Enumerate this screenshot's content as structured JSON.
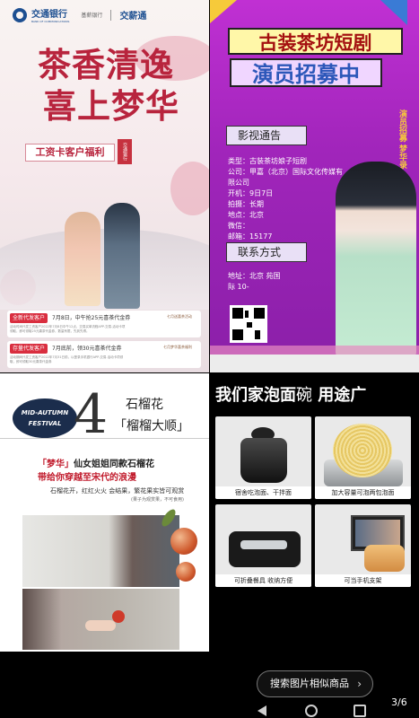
{
  "panel1": {
    "bank_name": "交通银行",
    "bank_en": "BANK OF COMMUNICATIONS",
    "sub_brand": "基薪银行",
    "salary_brand": "交薪通",
    "title_line1": "茶香清逸",
    "title_line2": "喜上梦华",
    "tag": "工资卡客户福利",
    "seal": "交通银行",
    "card1": {
      "label": "全新代发客户",
      "main": "7月8日，中午抢25元喜茶代金券",
      "desc": "活动时间代发工资客户2022年7月8日中午12点，交易买单流程APP-交易-活动卡项领取，即可领取25元喜茶代金券，数量有限，先到先得。",
      "side": "七月送喜茶活动"
    },
    "card2": {
      "label": "存量代发客户",
      "main": "7月底前，领30元喜茶代金券",
      "desc": "活动期间代发工资客户2022年7月31日前，以登录手机银行APP-交易-活动卡项领取，即可领取30元喜茶代金券",
      "side": "七月梦华喜茶福利"
    }
  },
  "panel2": {
    "title1": "古装茶坊短剧",
    "title2": "演员招募中",
    "section1": "影视通告",
    "info_lines": [
      "类型：古装茶坊娘子短剧",
      "公司：甲嘉（北京）国际文化传媒有",
      "限公司",
      "开机：9日7日",
      "拍摄：长期",
      "地点：北京",
      "微信：",
      "邮箱：15177"
    ],
    "section2": "联系方式",
    "address": "地址：北京          苑国",
    "address2": "际          10-",
    "vertical_text": "演员招募 梦华录"
  },
  "panel3": {
    "badge_line1": "MID-AUTUMN",
    "badge_line2": "FESTIVAL",
    "number": "4",
    "heading1": "石榴花",
    "heading2": "「榴榴大顺」",
    "sub1_quote": "「梦华」",
    "sub1_rest": "仙女姐姐同款石榴花",
    "sub2": "带给你穿越至宋代的浪漫",
    "sub3": "石榴花开，红红火火 会结果，繁花果实皆可观赏",
    "sub4": "(果子为观赏果，不可食用)"
  },
  "panel4": {
    "headline_bold": "我们家泡面",
    "headline_soft": "碗",
    "headline_tail": "用途广",
    "captions": [
      "宿舍吃泡面、干拌面",
      "加大容量可泡两包泡面",
      "可折叠餐具 收纳方便",
      "可当手机支架"
    ]
  },
  "bottom": {
    "search_label": "搜索图片相似商品",
    "page_indicator": "3/6"
  },
  "colors": {
    "bank_blue": "#1d4f91",
    "title_red": "#b8243d",
    "purple": "#a125bb"
  }
}
